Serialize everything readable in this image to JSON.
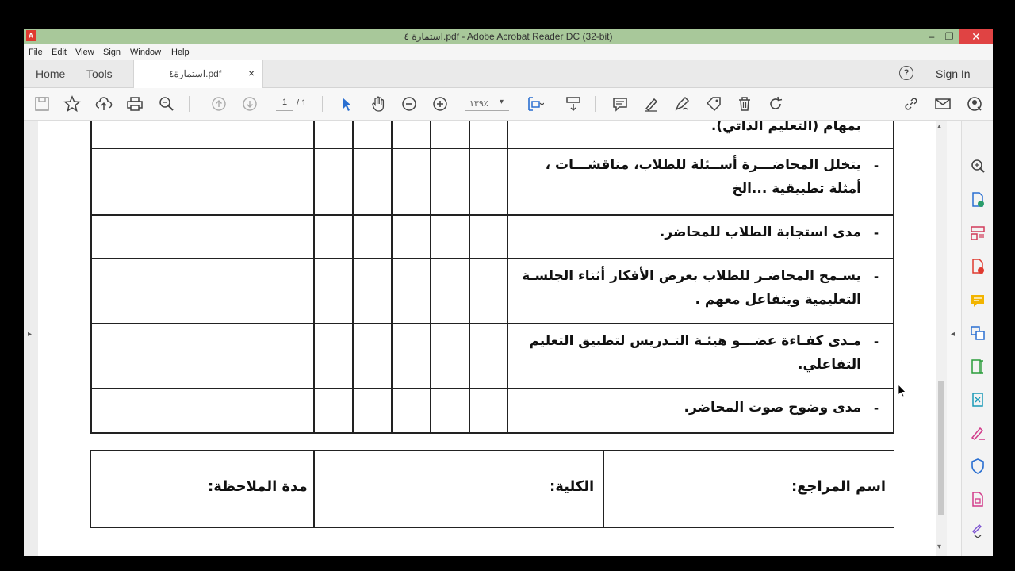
{
  "window": {
    "title": "استمارة ٤.pdf - Adobe Acrobat Reader DC (32-bit)",
    "controls": {
      "minimize": "–",
      "maximize": "❐",
      "close": "✕"
    }
  },
  "menu": [
    "File",
    "Edit",
    "View",
    "Sign",
    "Window",
    "Help"
  ],
  "tabs": {
    "home": "Home",
    "tools": "Tools",
    "document": "استمارة٤.pdf",
    "close": "×",
    "help": "?",
    "sign_in": "Sign In"
  },
  "toolbar": {
    "page_current": "1",
    "page_total": "/ 1",
    "zoom": "١٣٩٪"
  },
  "document": {
    "rows": [
      {
        "text": "بمهام (التعليم الذاتي)."
      },
      {
        "text": "يتخلل المحاضـــرة أســئلة للطلاب، مناقشـــات ، أمثلة تطبيقية ...الخ"
      },
      {
        "text": "مدى استجابة الطلاب للمحاضر."
      },
      {
        "text": "يسـمح المحاضـر للطلاب بعرض الأفكار أثناء الجلسـة التعليمية ويتفاعل معهم ."
      },
      {
        "text": "مـدى كفـاءة عضـــو هيئـة التـدريس لتطبيق التعليم التفاعلي."
      },
      {
        "text": "مدى وضوح صوت المحاضر."
      }
    ],
    "bullet": "-",
    "footer": {
      "reviewer_name": "اسم المراجع:",
      "college": "الكلية:",
      "observation_duration": "مدة الملاحظة:"
    }
  },
  "colors": {
    "titlebar": "#a8c89a",
    "close_button": "#e04343",
    "acrobat_red": "#e03a2f",
    "tool_blue": "#2a6fd1",
    "tool_pink": "#d23b8a"
  },
  "icons": {
    "toolbar": [
      "save-icon",
      "bookmark-star-icon",
      "upload-cloud-icon",
      "print-icon",
      "zoom-search-icon",
      "page-up-icon",
      "page-down-icon",
      "select-arrow-icon",
      "hand-icon",
      "zoom-out-icon",
      "zoom-in-icon",
      "fit-page-icon",
      "scroll-mode-icon",
      "comment-icon",
      "highlight-pen-icon",
      "draw-icon",
      "stamp-icon",
      "trash-icon",
      "rotate-icon",
      "share-link-icon",
      "email-icon",
      "account-icon"
    ],
    "right_panel": [
      "zoom-icon",
      "export-pdf-icon",
      "organize-pages-icon",
      "create-pdf-icon",
      "comment-icon",
      "combine-files-icon",
      "edit-pdf-icon",
      "compress-icon",
      "fill-sign-icon",
      "protect-icon",
      "more-tools-icon",
      "sign-icon",
      "expand-icon"
    ]
  }
}
